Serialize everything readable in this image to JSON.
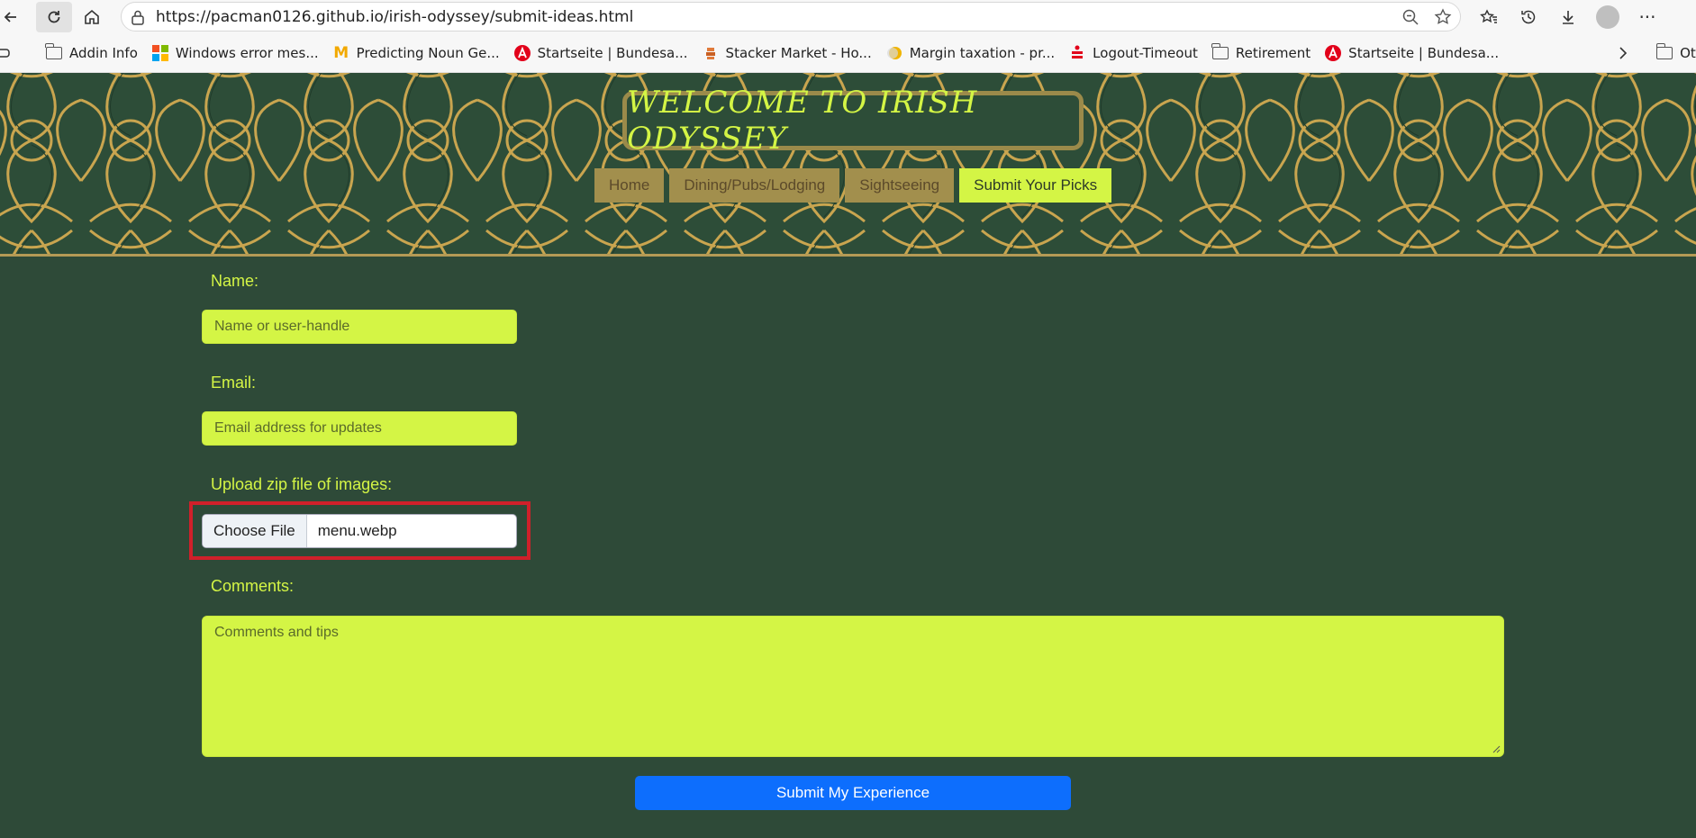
{
  "browser": {
    "url": "https://pacman0126.github.io/irish-odyssey/submit-ideas.html",
    "bookmarks": [
      {
        "label": "Addin Info",
        "icon": "folder-icon"
      },
      {
        "label": "Windows error mes...",
        "icon": "windows-logo-icon"
      },
      {
        "label": "Predicting Noun Ge...",
        "icon": "m-logo-icon"
      },
      {
        "label": "Startseite | Bundesa...",
        "icon": "red-a-logo-icon"
      },
      {
        "label": "Stacker Market - Ho...",
        "icon": "stacker-icon"
      },
      {
        "label": "Margin taxation - pr...",
        "icon": "yellow-circle-icon"
      },
      {
        "label": "Logout-Timeout",
        "icon": "sparkasse-icon"
      },
      {
        "label": "Retirement",
        "icon": "folder-icon"
      },
      {
        "label": "Startseite | Bundesa...",
        "icon": "red-a-logo-icon"
      }
    ],
    "other_favorites": "Other favorite"
  },
  "site": {
    "title": "WELCOME TO IRISH ODYSSEY",
    "nav": [
      {
        "label": "Home",
        "active": false
      },
      {
        "label": "Dining/Pubs/Lodging",
        "active": false
      },
      {
        "label": "Sightseeing",
        "active": false
      },
      {
        "label": "Submit Your Picks",
        "active": true
      }
    ]
  },
  "form": {
    "name_label": "Name:",
    "name_placeholder": "Name or user-handle",
    "email_label": "Email:",
    "email_placeholder": "Email address for updates",
    "upload_label": "Upload zip file of images:",
    "file_button": "Choose File",
    "file_name": "menu.webp",
    "comments_label": "Comments:",
    "comments_placeholder": "Comments and tips",
    "submit_label": "Submit My Experience"
  },
  "colors": {
    "background": "#2e4a38",
    "accent": "#d4f545",
    "gold": "#a28f4d",
    "submit": "#0d6efd",
    "highlight": "#d0202a"
  }
}
